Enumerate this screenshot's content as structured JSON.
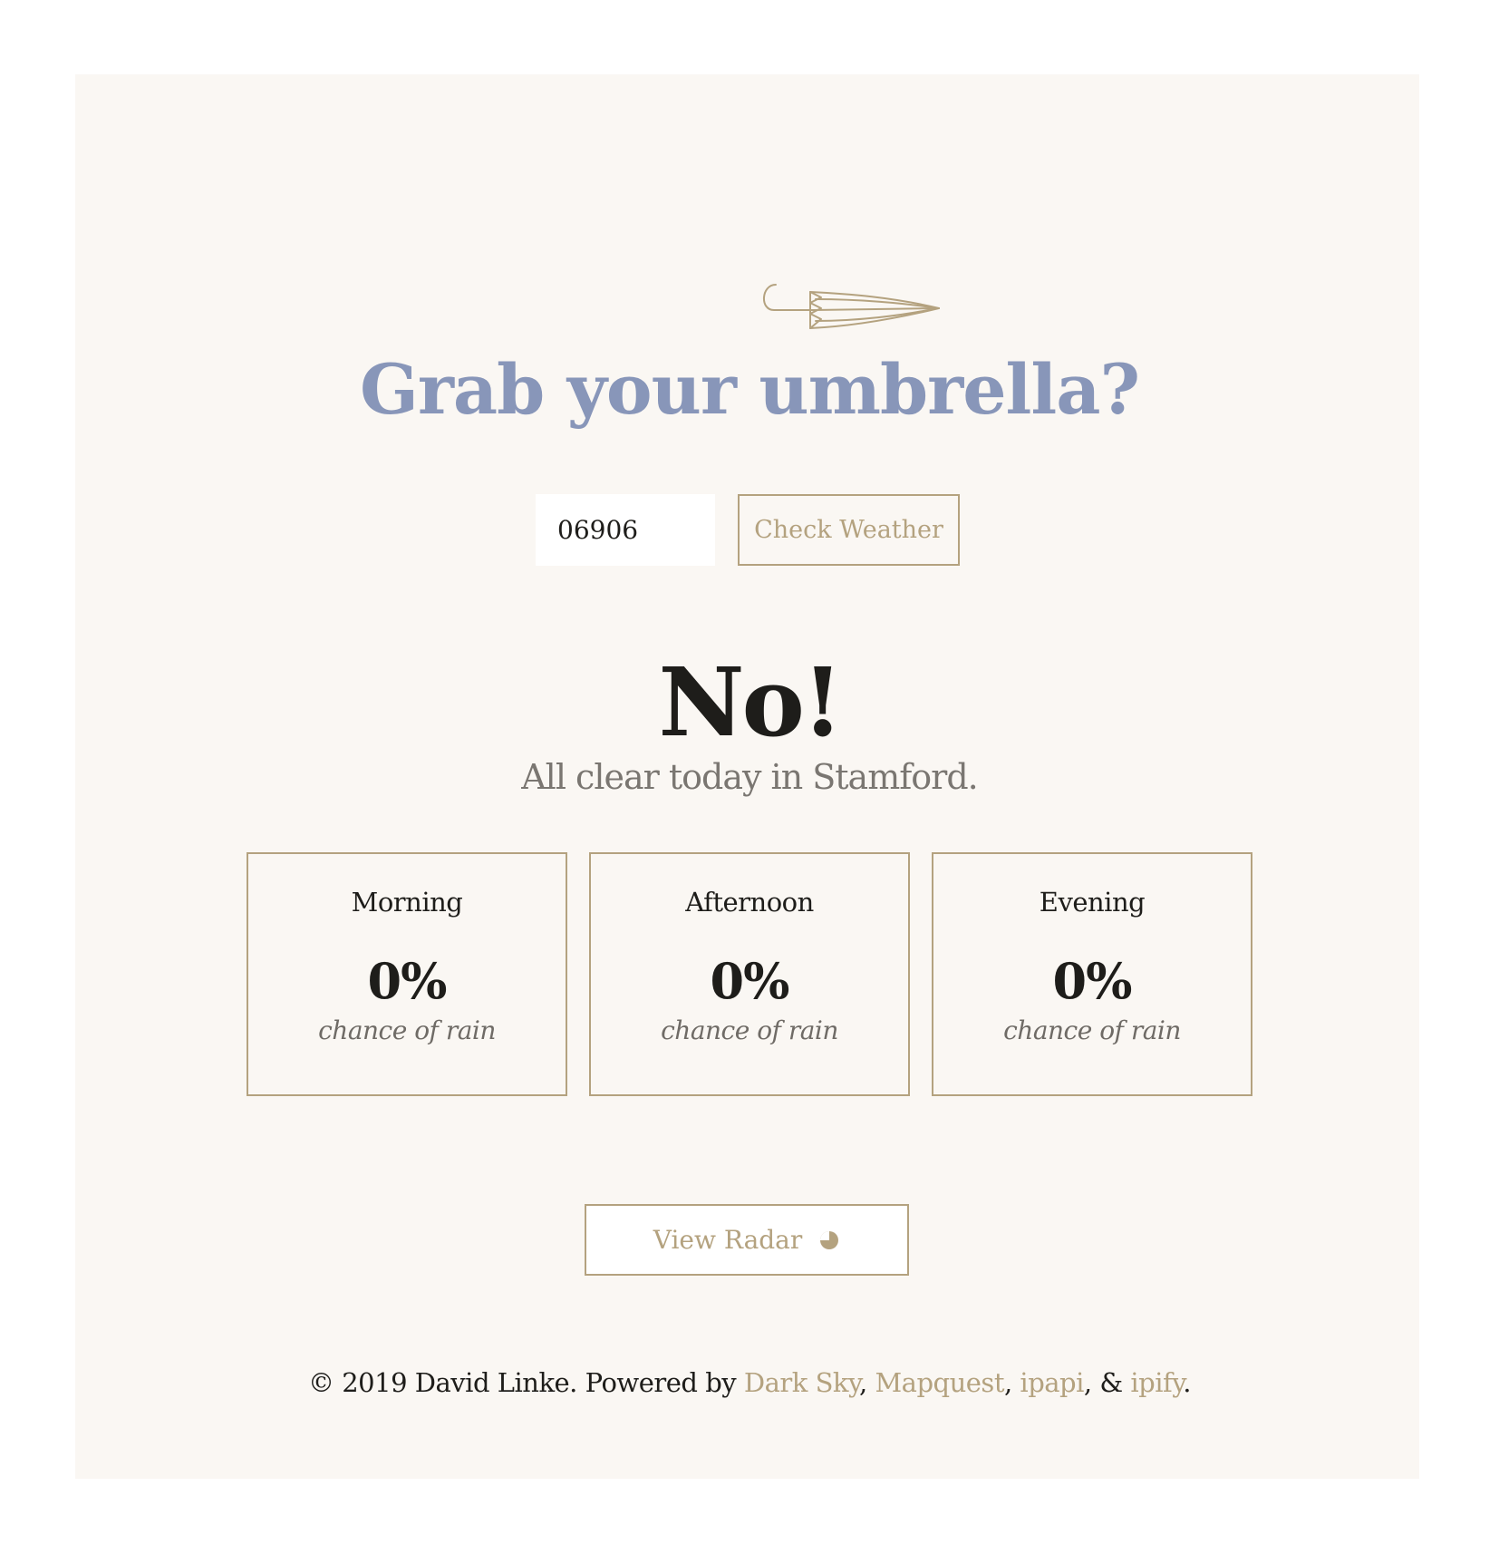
{
  "header": {
    "logo_icon": "umbrella-icon",
    "headline": "Grab your umbrella?"
  },
  "search": {
    "zip_value": "06906",
    "button_label": "Check Weather"
  },
  "result": {
    "answer": "No!",
    "summary": "All clear today in Stamford."
  },
  "forecast": [
    {
      "period": "Morning",
      "percent": "0%",
      "caption": "chance of rain"
    },
    {
      "period": "Afternoon",
      "percent": "0%",
      "caption": "chance of rain"
    },
    {
      "period": "Evening",
      "percent": "0%",
      "caption": "chance of rain"
    }
  ],
  "radar": {
    "label": "View Radar",
    "icon": "radar-icon"
  },
  "footer": {
    "copyright_symbol": "©",
    "text": " 2019 David Linke. Powered by ",
    "links": [
      "Dark Sky",
      "Mapquest",
      "ipapi",
      "ipify"
    ],
    "sep1": ", ",
    "sep2": ", ",
    "sep3": ", & ",
    "end": "."
  },
  "colors": {
    "background": "#faf7f3",
    "accent": "#b4a27f",
    "headline": "#8896b9",
    "text": "#1e1d1a"
  }
}
